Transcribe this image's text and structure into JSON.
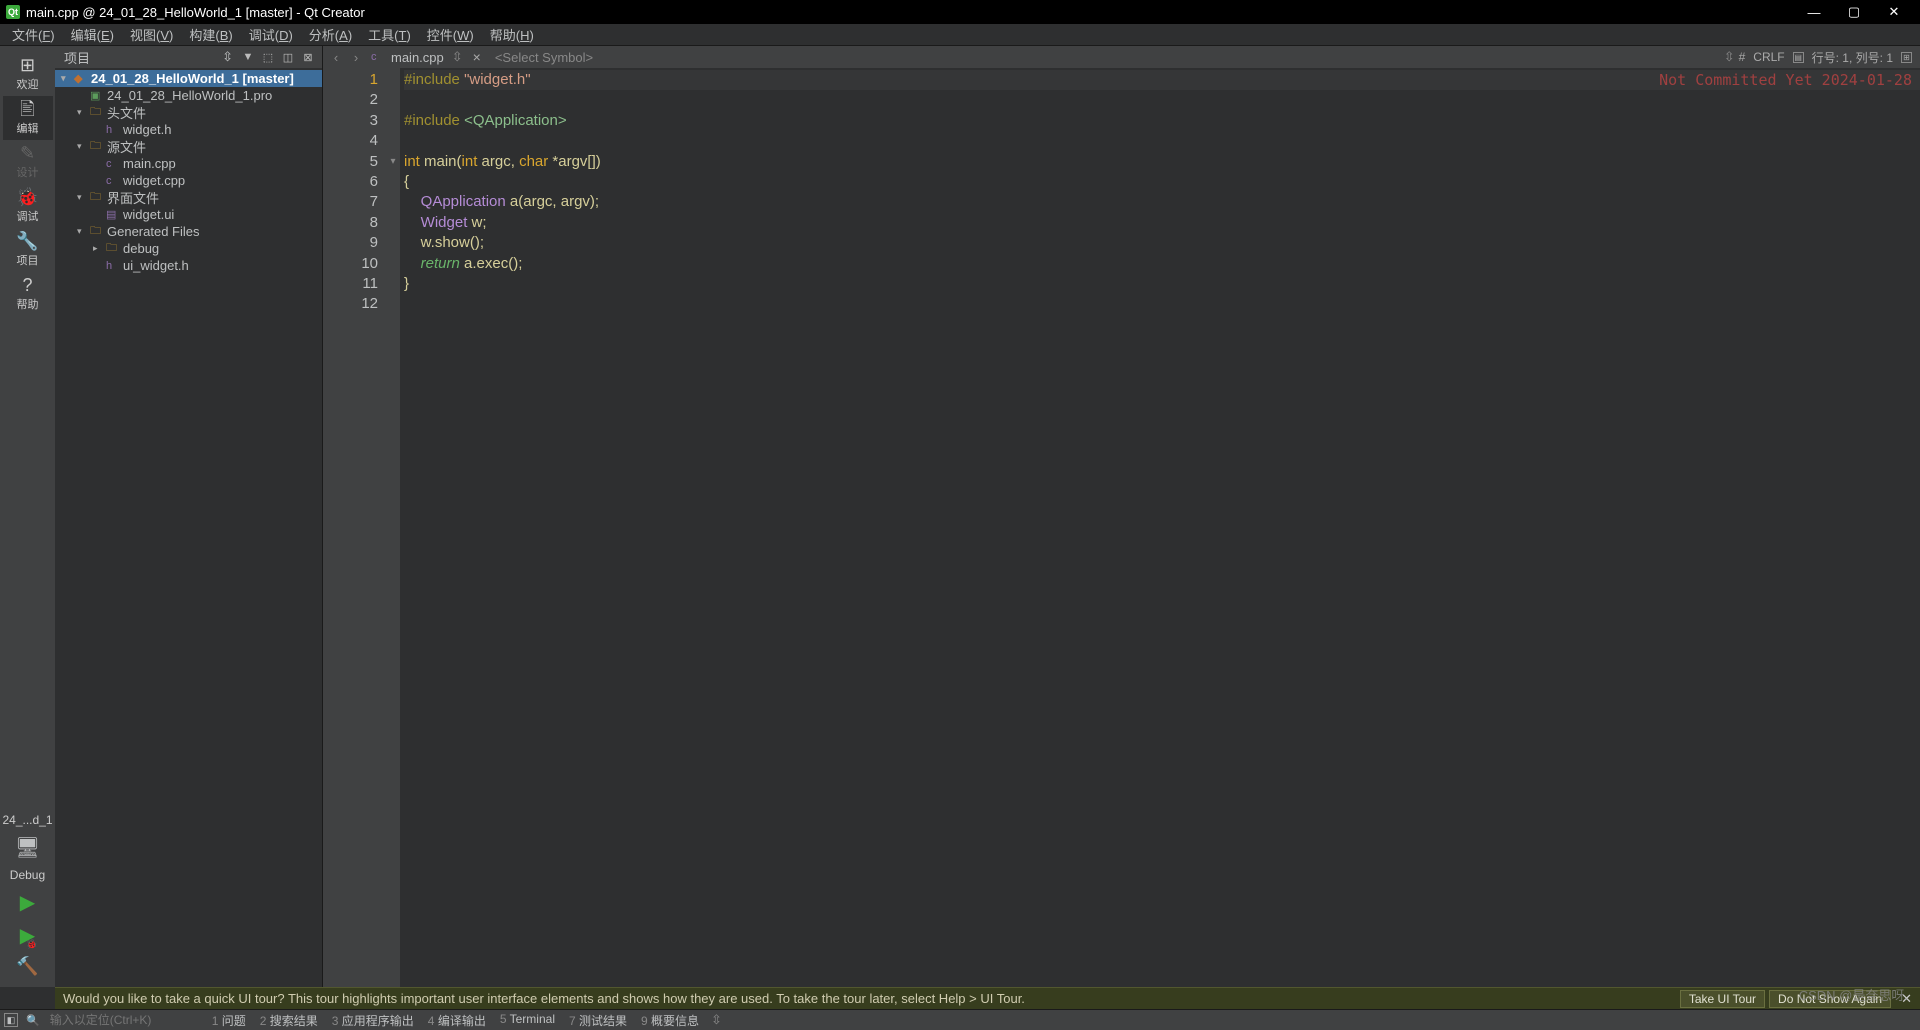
{
  "titlebar": {
    "title": "main.cpp @ 24_01_28_HelloWorld_1 [master] - Qt Creator"
  },
  "menubar": {
    "items": [
      {
        "label": "文件",
        "mn": "F"
      },
      {
        "label": "编辑",
        "mn": "E"
      },
      {
        "label": "视图",
        "mn": "V"
      },
      {
        "label": "构建",
        "mn": "B"
      },
      {
        "label": "调试",
        "mn": "D"
      },
      {
        "label": "分析",
        "mn": "A"
      },
      {
        "label": "工具",
        "mn": "T"
      },
      {
        "label": "控件",
        "mn": "W"
      },
      {
        "label": "帮助",
        "mn": "H"
      }
    ]
  },
  "leftbar": {
    "items": [
      {
        "icon": "⊞",
        "label": "欢迎"
      },
      {
        "icon": "🖹",
        "label": "编辑"
      },
      {
        "icon": "✎",
        "label": "设计"
      },
      {
        "icon": "🐞",
        "label": "调试"
      },
      {
        "icon": "🔧",
        "label": "项目"
      },
      {
        "icon": "?",
        "label": "帮助"
      }
    ],
    "target": "24_...d_1",
    "mode": "Debug"
  },
  "project_panel": {
    "title": "项目",
    "tree": [
      {
        "depth": 0,
        "arrow": "▾",
        "icon": "◆",
        "iconcls": "git",
        "label": "24_01_28_HelloWorld_1 [master]",
        "bold": true
      },
      {
        "depth": 1,
        "arrow": "",
        "icon": "▣",
        "iconcls": "proj",
        "label": "24_01_28_HelloWorld_1.pro"
      },
      {
        "depth": 1,
        "arrow": "▾",
        "icon": "🗀",
        "iconcls": "folder-y",
        "label": "头文件"
      },
      {
        "depth": 2,
        "arrow": "",
        "icon": "h",
        "iconcls": "file-h",
        "label": "widget.h"
      },
      {
        "depth": 1,
        "arrow": "▾",
        "icon": "🗀",
        "iconcls": "folder-y",
        "label": "源文件"
      },
      {
        "depth": 2,
        "arrow": "",
        "icon": "c",
        "iconcls": "file-h",
        "label": "main.cpp"
      },
      {
        "depth": 2,
        "arrow": "",
        "icon": "c",
        "iconcls": "file-h",
        "label": "widget.cpp"
      },
      {
        "depth": 1,
        "arrow": "▾",
        "icon": "🗀",
        "iconcls": "folder-y",
        "label": "界面文件"
      },
      {
        "depth": 2,
        "arrow": "",
        "icon": "▤",
        "iconcls": "file-h",
        "label": "widget.ui"
      },
      {
        "depth": 1,
        "arrow": "▾",
        "icon": "🗀",
        "iconcls": "folder-y",
        "label": "Generated Files"
      },
      {
        "depth": 2,
        "arrow": "▸",
        "icon": "🗀",
        "iconcls": "folder-y",
        "label": "debug"
      },
      {
        "depth": 2,
        "arrow": "",
        "icon": "h",
        "iconcls": "file-h",
        "label": "ui_widget.h"
      }
    ]
  },
  "editor": {
    "filename": "main.cpp",
    "symbol_placeholder": "<Select Symbol>",
    "encoding_indicator": "#",
    "line_ending": "CRLF",
    "cursor_pos": "行号: 1, 列号: 1",
    "git_annotation": "Not Committed Yet 2024-01-28",
    "lines": [
      {
        "n": 1,
        "html": "<span class='tok-pre'>#include</span> <span class='tok-str'>\"widget.h\"</span>"
      },
      {
        "n": 2,
        "html": ""
      },
      {
        "n": 3,
        "html": "<span class='tok-pre'>#include</span> <span class='tok-inc'>&lt;QApplication&gt;</span>"
      },
      {
        "n": 4,
        "html": ""
      },
      {
        "n": 5,
        "html": "<span class='tok-type'>int</span> <span class='tok-func'>main</span>(<span class='tok-type'>int</span> argc, <span class='tok-type'>char</span> *argv[])",
        "fold": "▾"
      },
      {
        "n": 6,
        "html": "{"
      },
      {
        "n": 7,
        "html": "    <span class='tok-type2'>QApplication</span> a(argc, argv);"
      },
      {
        "n": 8,
        "html": "    <span class='tok-type2'>Widget</span> w;"
      },
      {
        "n": 9,
        "html": "    w.show();"
      },
      {
        "n": 10,
        "html": "    <span class='tok-ret'>return</span> a.exec();"
      },
      {
        "n": 11,
        "html": "}"
      },
      {
        "n": 12,
        "html": ""
      }
    ]
  },
  "tour": {
    "message": "Would you like to take a quick UI tour? This tour highlights important user interface elements and shows how they are used. To take the tour later, select Help > UI Tour.",
    "take": "Take UI Tour",
    "dont": "Do Not Show Again"
  },
  "statusbar": {
    "search_placeholder": "输入以定位(Ctrl+K)",
    "outputs": [
      {
        "n": "1",
        "label": "问题"
      },
      {
        "n": "2",
        "label": "搜索结果"
      },
      {
        "n": "3",
        "label": "应用程序输出"
      },
      {
        "n": "4",
        "label": "编译输出"
      },
      {
        "n": "5",
        "label": "Terminal"
      },
      {
        "n": "7",
        "label": "测试结果"
      },
      {
        "n": "9",
        "label": "概要信息"
      }
    ]
  },
  "watermark": "CSDN @是奈思呀."
}
